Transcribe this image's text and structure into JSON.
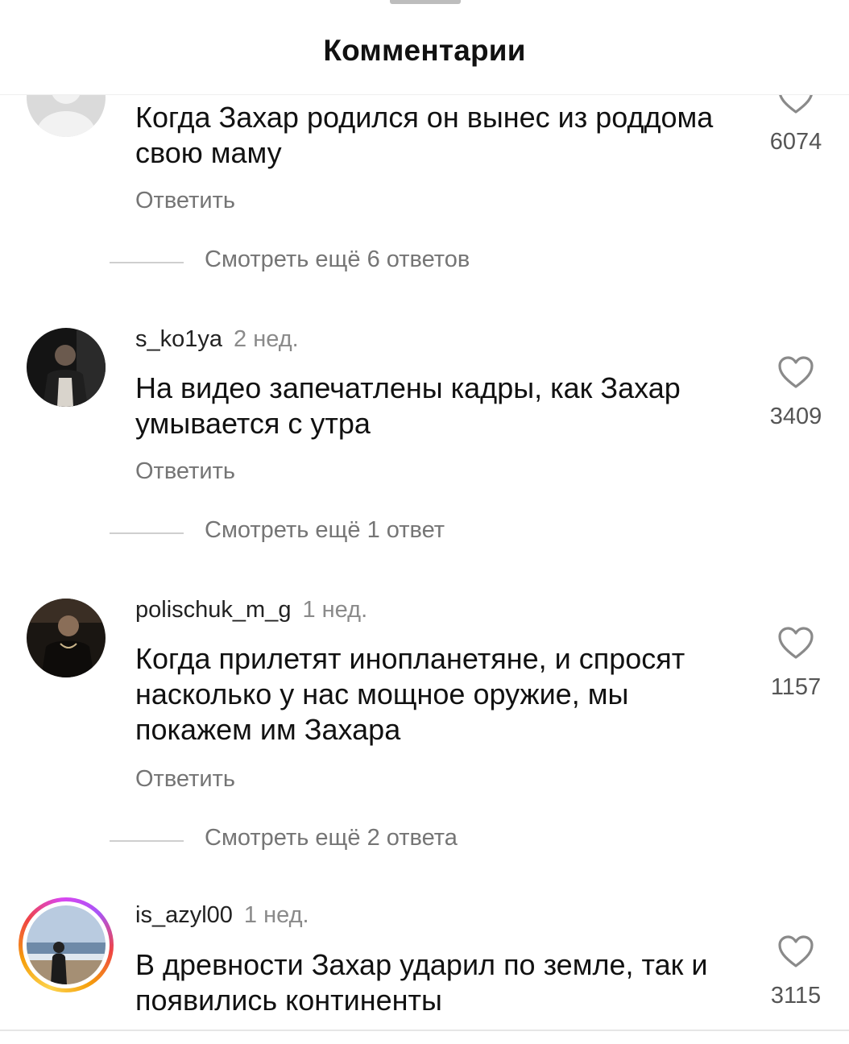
{
  "header": {
    "title": "Комментарии"
  },
  "comments": [
    {
      "username": "",
      "time": "",
      "text": "Когда Захар родился он вынес из роддома свою маму",
      "likes": "6074",
      "reply_label": "Ответить",
      "more_replies": "Смотреть ещё 6 ответов",
      "avatar_icon": "default-user-icon"
    },
    {
      "username": "s_ko1ya",
      "time": "2 нед.",
      "text": "На видео запечатлены кадры, как Захар умывается с утра",
      "likes": "3409",
      "reply_label": "Ответить",
      "more_replies": "Смотреть ещё 1 ответ"
    },
    {
      "username": "polischuk_m_g",
      "time": "1 нед.",
      "text": "Когда прилетят инопланетяне, и спросят насколько у нас мощное оружие, мы покажем им Захара",
      "likes": "1157",
      "reply_label": "Ответить",
      "more_replies": "Смотреть ещё 2 ответа"
    },
    {
      "username": "is_azyl00",
      "time": "1 нед.",
      "text": "В древности Захар ударил по земле, так и появились континенты",
      "likes": "3115",
      "has_story": true
    }
  ],
  "colors": {
    "secondary_text": "#757575",
    "like_icon": "#8a8a8a",
    "divider": "#cfcfcf"
  }
}
